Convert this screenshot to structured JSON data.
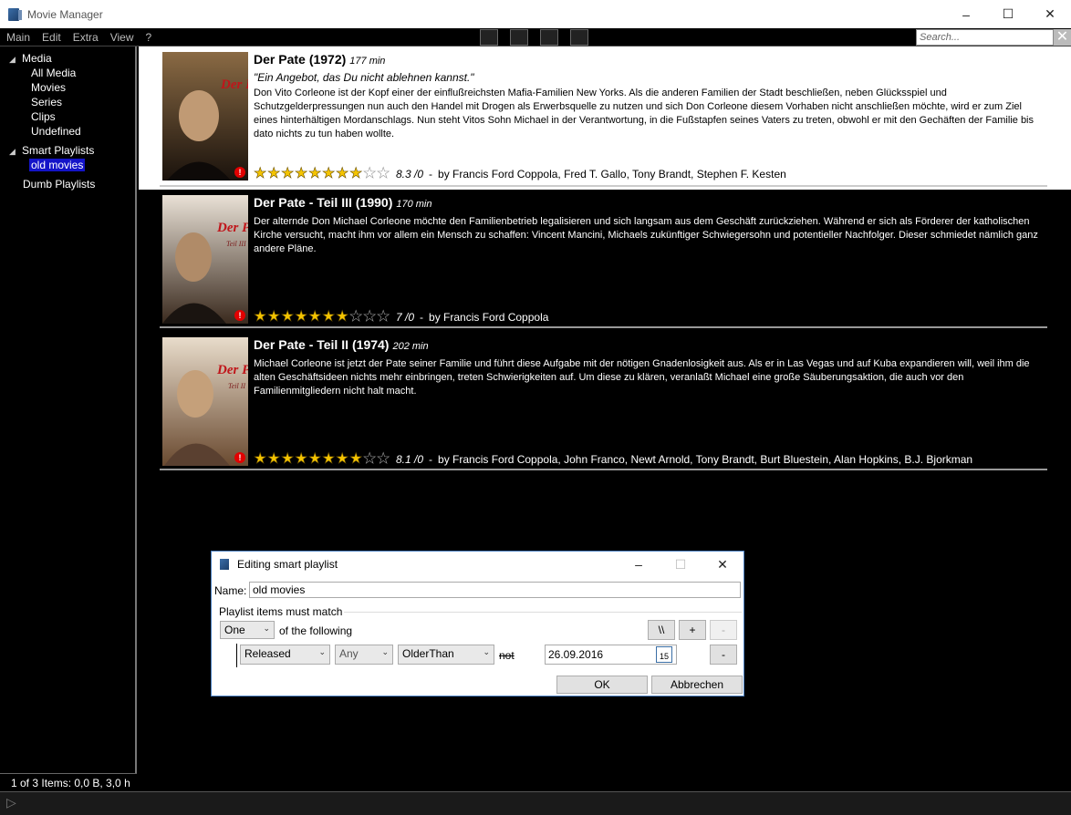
{
  "window": {
    "title": "Movie Manager"
  },
  "menu": [
    "Main",
    "Edit",
    "Extra",
    "View",
    "?"
  ],
  "search": {
    "placeholder": "Search..."
  },
  "sidebar": {
    "media": "Media",
    "media_items": [
      "All Media",
      "Movies",
      "Series",
      "Clips",
      "Undefined"
    ],
    "smart_playlists": "Smart Playlists",
    "smart_items": [
      "old movies"
    ],
    "dumb_playlists": "Dumb Playlists"
  },
  "status": "1 of 3 Items: 0,0 B, 3,0 h",
  "movies": [
    {
      "title": "Der Pate",
      "year": "(1972)",
      "duration": "177 min",
      "tagline": "\"Ein Angebot, das Du nicht ablehnen kannst.\"",
      "description": "Don Vito Corleone ist der Kopf einer der einflußreichsten Mafia-Familien New Yorks. Als die anderen Familien der Stadt beschließen, neben Glücksspiel und Schutzgelderpressungen nun auch den Handel mit Drogen als Erwerbsquelle zu nutzen und sich Don Corleone diesem Vorhaben nicht anschließen möchte, wird er zum Ziel eines hinterhältigen Mordanschlags. Nun steht Vitos Sohn Michael in der Verantwortung, in die Fußstapfen seines Vaters zu treten, obwohl er mit den Gechäften der Familie bis dato nichts zu tun haben wollte.",
      "rating": "8.3 /0",
      "stars": 8.3,
      "credits": "by Francis Ford Coppola, Fred T. Gallo, Tony Brandt, Stephen F. Kesten",
      "poster_text": "Der Pate",
      "poster_sub": ""
    },
    {
      "title": "Der Pate - Teil III",
      "year": "(1990)",
      "duration": "170 min",
      "tagline": "",
      "description": "Der alternde Don Michael Corleone möchte den Familienbetrieb legalisieren und sich langsam aus dem Geschäft zurückziehen. Während er sich als Förderer der katholischen Kirche versucht, macht ihm vor allem ein Mensch zu schaffen: Vincent Mancini, Michaels zukünftiger Schwiegersohn und potentieller Nachfolger. Dieser schmiedet nämlich ganz andere Pläne.",
      "rating": "7 /0",
      "stars": 7,
      "credits": "by Francis Ford Coppola",
      "poster_text": "Der Pate",
      "poster_sub": "Teil III"
    },
    {
      "title": "Der Pate - Teil II",
      "year": "(1974)",
      "duration": "202 min",
      "tagline": "",
      "description": "Michael Corleone ist jetzt der Pate seiner Familie und führt diese Aufgabe mit der nötigen Gnadenlosigkeit aus. Als er in Las Vegas und auf Kuba expandieren will, weil ihm die alten Geschäftsideen nichts mehr einbringen, treten Schwierigkeiten auf. Um diese zu klären, veranlaßt Michael eine große Säuberungsaktion, die auch vor den Familienmitgliedern nicht halt macht.",
      "rating": "8.1 /0",
      "stars": 8.1,
      "credits": "by Francis Ford Coppola, John Franco, Newt Arnold, Tony Brandt, Burt Bluestein, Alan Hopkins, B.J. Bjorkman",
      "poster_text": "Der Pate",
      "poster_sub": "Teil II"
    }
  ],
  "dialog": {
    "title": "Editing smart playlist",
    "name_label": "Name:",
    "name_value": "old movies",
    "group_label": "Playlist items must match",
    "match_mode": "One",
    "of_following": "of the following",
    "btn_group": "\\\\",
    "btn_add": "+",
    "btn_remove_top": "-",
    "field": "Released",
    "scope": "Any",
    "operator": "OlderThan",
    "not_label": "not",
    "date_value": "26.09.2016",
    "calendar_day": "15",
    "btn_remove_row": "-",
    "ok": "OK",
    "cancel": "Abbrechen"
  }
}
